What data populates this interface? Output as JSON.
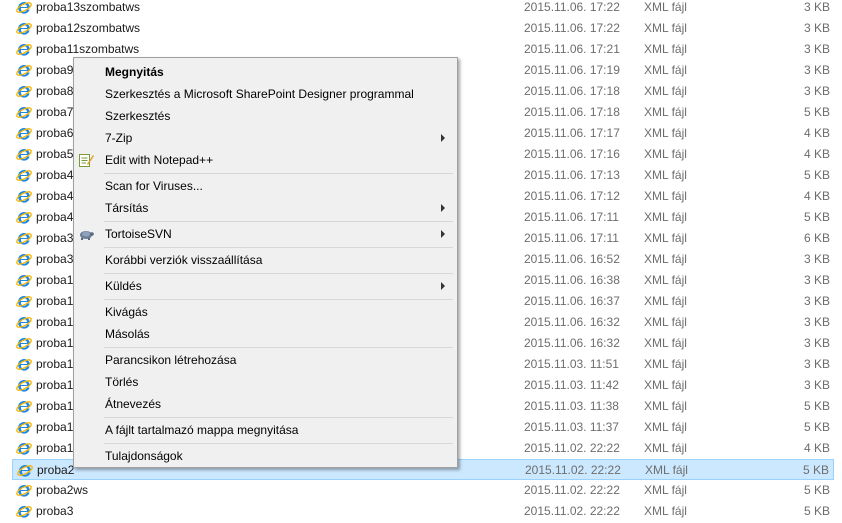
{
  "files": [
    {
      "name": "proba13szombatws",
      "date": "2015.11.06. 17:22",
      "type": "XML fájl",
      "size": "3 KB",
      "selected": false
    },
    {
      "name": "proba12szombatws",
      "date": "2015.11.06. 17:22",
      "type": "XML fájl",
      "size": "3 KB",
      "selected": false
    },
    {
      "name": "proba11szombatws",
      "date": "2015.11.06. 17:21",
      "type": "XML fájl",
      "size": "3 KB",
      "selected": false
    },
    {
      "name": "proba9",
      "date": "2015.11.06. 17:19",
      "type": "XML fájl",
      "size": "3 KB",
      "selected": false
    },
    {
      "name": "proba8",
      "date": "2015.11.06. 17:18",
      "type": "XML fájl",
      "size": "3 KB",
      "selected": false
    },
    {
      "name": "proba7",
      "date": "2015.11.06. 17:18",
      "type": "XML fájl",
      "size": "5 KB",
      "selected": false
    },
    {
      "name": "proba6",
      "date": "2015.11.06. 17:17",
      "type": "XML fájl",
      "size": "4 KB",
      "selected": false
    },
    {
      "name": "proba5",
      "date": "2015.11.06. 17:16",
      "type": "XML fájl",
      "size": "4 KB",
      "selected": false
    },
    {
      "name": "proba4",
      "date": "2015.11.06. 17:13",
      "type": "XML fájl",
      "size": "5 KB",
      "selected": false
    },
    {
      "name": "proba4",
      "date": "2015.11.06. 17:12",
      "type": "XML fájl",
      "size": "4 KB",
      "selected": false
    },
    {
      "name": "proba4",
      "date": "2015.11.06. 17:11",
      "type": "XML fájl",
      "size": "5 KB",
      "selected": false
    },
    {
      "name": "proba3",
      "date": "2015.11.06. 17:11",
      "type": "XML fájl",
      "size": "6 KB",
      "selected": false
    },
    {
      "name": "proba3",
      "date": "2015.11.06. 16:52",
      "type": "XML fájl",
      "size": "3 KB",
      "selected": false
    },
    {
      "name": "proba1",
      "date": "2015.11.06. 16:38",
      "type": "XML fájl",
      "size": "3 KB",
      "selected": false
    },
    {
      "name": "proba1",
      "date": "2015.11.06. 16:37",
      "type": "XML fájl",
      "size": "3 KB",
      "selected": false
    },
    {
      "name": "proba1",
      "date": "2015.11.06. 16:32",
      "type": "XML fájl",
      "size": "3 KB",
      "selected": false
    },
    {
      "name": "proba1",
      "date": "2015.11.06. 16:32",
      "type": "XML fájl",
      "size": "3 KB",
      "selected": false
    },
    {
      "name": "proba1",
      "date": "2015.11.03. 11:51",
      "type": "XML fájl",
      "size": "3 KB",
      "selected": false
    },
    {
      "name": "proba1",
      "date": "2015.11.03. 11:42",
      "type": "XML fájl",
      "size": "3 KB",
      "selected": false
    },
    {
      "name": "proba1",
      "date": "2015.11.03. 11:38",
      "type": "XML fájl",
      "size": "5 KB",
      "selected": false
    },
    {
      "name": "proba1",
      "date": "2015.11.03. 11:37",
      "type": "XML fájl",
      "size": "5 KB",
      "selected": false
    },
    {
      "name": "proba1",
      "date": "2015.11.02. 22:22",
      "type": "XML fájl",
      "size": "4 KB",
      "selected": false
    },
    {
      "name": "proba2",
      "date": "2015.11.02. 22:22",
      "type": "XML fájl",
      "size": "5 KB",
      "selected": true
    },
    {
      "name": "proba2ws",
      "date": "2015.11.02. 22:22",
      "type": "XML fájl",
      "size": "5 KB",
      "selected": false
    },
    {
      "name": "proba3",
      "date": "2015.11.02. 22:22",
      "type": "XML fájl",
      "size": "5 KB",
      "selected": false
    }
  ],
  "context_menu": {
    "items": [
      {
        "label": "Megnyitás",
        "bold": true,
        "submenu": false,
        "icon": ""
      },
      {
        "label": "Szerkesztés a Microsoft SharePoint Designer programmal",
        "bold": false,
        "submenu": false,
        "icon": ""
      },
      {
        "label": "Szerkesztés",
        "bold": false,
        "submenu": false,
        "icon": ""
      },
      {
        "label": "7-Zip",
        "bold": false,
        "submenu": true,
        "icon": ""
      },
      {
        "label": "Edit with Notepad++",
        "bold": false,
        "submenu": false,
        "icon": "notepadpp-icon"
      },
      {
        "separator": true
      },
      {
        "label": "Scan for Viruses...",
        "bold": false,
        "submenu": false,
        "icon": ""
      },
      {
        "label": "Társítás",
        "bold": false,
        "submenu": true,
        "icon": ""
      },
      {
        "separator": true
      },
      {
        "label": "TortoiseSVN",
        "bold": false,
        "submenu": true,
        "icon": "tortoisesvn-icon"
      },
      {
        "separator": true
      },
      {
        "label": "Korábbi verziók visszaállítása",
        "bold": false,
        "submenu": false,
        "icon": ""
      },
      {
        "separator": true
      },
      {
        "label": "Küldés",
        "bold": false,
        "submenu": true,
        "icon": ""
      },
      {
        "separator": true
      },
      {
        "label": "Kivágás",
        "bold": false,
        "submenu": false,
        "icon": ""
      },
      {
        "label": "Másolás",
        "bold": false,
        "submenu": false,
        "icon": ""
      },
      {
        "separator": true
      },
      {
        "label": "Parancsikon létrehozása",
        "bold": false,
        "submenu": false,
        "icon": ""
      },
      {
        "label": "Törlés",
        "bold": false,
        "submenu": false,
        "icon": ""
      },
      {
        "label": "Átnevezés",
        "bold": false,
        "submenu": false,
        "icon": ""
      },
      {
        "separator": true
      },
      {
        "label": "A fájlt tartalmazó mappa megnyitása",
        "bold": false,
        "submenu": false,
        "icon": ""
      },
      {
        "separator": true
      },
      {
        "label": "Tulajdonságok",
        "bold": false,
        "submenu": false,
        "icon": ""
      }
    ]
  },
  "colors": {
    "selection_bg": "#cce8ff",
    "selection_border": "#99d1ff",
    "menu_bg": "#f0f0f0",
    "ie_icon": "#1e88e5"
  },
  "file_icon": "internet-explorer-icon"
}
